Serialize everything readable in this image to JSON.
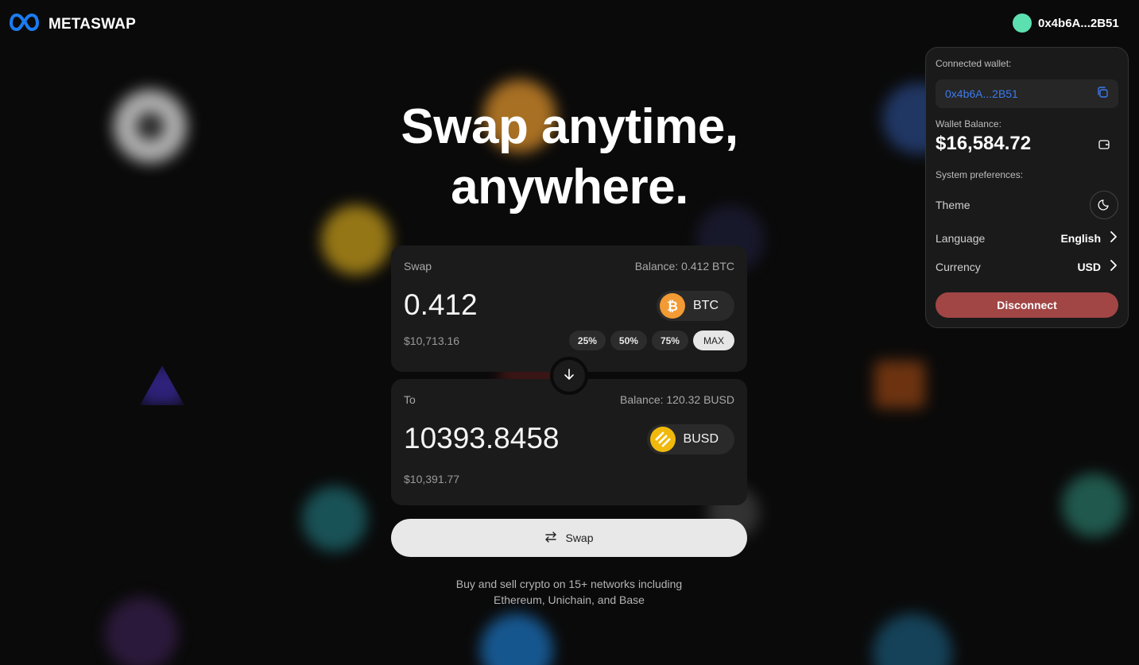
{
  "header": {
    "logo_text": "METASWAP",
    "wallet_address": "0x4b6A...2B51",
    "wallet_avatar_color": "#5de0b0"
  },
  "hero": {
    "line1": "Swap anytime,",
    "line2": "anywhere."
  },
  "swap_from": {
    "label": "Swap",
    "balance": "Balance: 0.412 BTC",
    "amount": "0.412",
    "fiat_value": "$10,713.16",
    "token": "BTC",
    "token_icon": "bitcoin-icon",
    "token_color": "#f29a33",
    "percent_buttons": [
      "25%",
      "50%",
      "75%",
      "MAX"
    ]
  },
  "swap_to": {
    "label": "To",
    "balance": "Balance: 120.32 BUSD",
    "amount": "10393.8458",
    "fiat_value": "$10,391.77",
    "token": "BUSD",
    "token_icon": "busd-icon",
    "token_color": "#f0b90b"
  },
  "swap_button": {
    "label": "Swap",
    "icon": "arrows-swap-icon"
  },
  "footer": {
    "line1": "Buy and sell crypto on 15+ networks including",
    "line2": "Ethereum, Unichain, and Base"
  },
  "wallet_dropdown": {
    "connected_label": "Connected wallet:",
    "address": "0x4b6A...2B51",
    "balance_label": "Wallet Balance:",
    "balance": "$16,584.72",
    "prefs_label": "System preferences:",
    "theme_label": "Theme",
    "language_label": "Language",
    "language_value": "English",
    "currency_label": "Currency",
    "currency_value": "USD",
    "disconnect_label": "Disconnect",
    "address_color": "#3c7bf0",
    "disconnect_color": "#a14545"
  }
}
